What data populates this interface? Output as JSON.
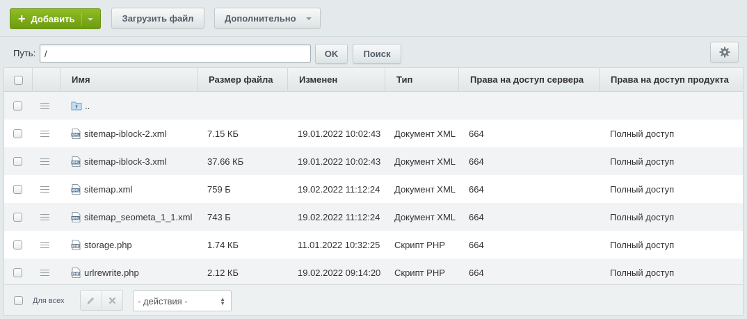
{
  "toolbar": {
    "add_label": "Добавить",
    "upload_label": "Загрузить файл",
    "more_label": "Дополнительно"
  },
  "path": {
    "label": "Путь:",
    "value": "/",
    "ok_label": "OK",
    "search_label": "Поиск"
  },
  "table": {
    "columns": [
      "Имя",
      "Размер файла",
      "Изменен",
      "Тип",
      "Права на доступ сервера",
      "Права на доступ продукта"
    ],
    "parent_label": "..",
    "rows": [
      {
        "name": "sitemap-iblock-2.xml",
        "size": "7.15 КБ",
        "modified": "19.01.2022 10:02:43",
        "type": "Документ XML",
        "server_rights": "664",
        "product_rights": "Полный доступ",
        "icon": "xml-file-icon"
      },
      {
        "name": "sitemap-iblock-3.xml",
        "size": "37.66 КБ",
        "modified": "19.01.2022 10:02:43",
        "type": "Документ XML",
        "server_rights": "664",
        "product_rights": "Полный доступ",
        "icon": "xml-file-icon"
      },
      {
        "name": "sitemap.xml",
        "size": "759 Б",
        "modified": "19.02.2022 11:12:24",
        "type": "Документ XML",
        "server_rights": "664",
        "product_rights": "Полный доступ",
        "icon": "xml-file-icon"
      },
      {
        "name": "sitemap_seometa_1_1.xml",
        "size": "743 Б",
        "modified": "19.02.2022 11:12:24",
        "type": "Документ XML",
        "server_rights": "664",
        "product_rights": "Полный доступ",
        "icon": "xml-file-icon"
      },
      {
        "name": "storage.php",
        "size": "1.74 КБ",
        "modified": "11.01.2022 10:32:25",
        "type": "Скрипт PHP",
        "server_rights": "664",
        "product_rights": "Полный доступ",
        "icon": "php-file-icon"
      },
      {
        "name": "urlrewrite.php",
        "size": "2.12 КБ",
        "modified": "19.02.2022 09:14:20",
        "type": "Скрипт PHP",
        "server_rights": "664",
        "product_rights": "Полный доступ",
        "icon": "php-file-icon"
      }
    ]
  },
  "footer": {
    "for_all_label": "Для всех",
    "actions_value": "- действия -"
  },
  "colors": {
    "accent_green": "#7aab17",
    "row_alt": "#f1f3f4"
  }
}
